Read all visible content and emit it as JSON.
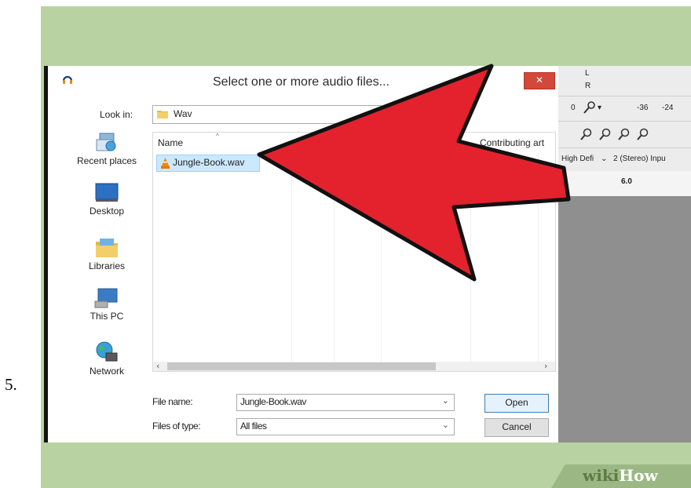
{
  "step_number": "5.",
  "dialog": {
    "title": "Select one or more audio files...",
    "close_glyph": "✕",
    "look_in_label": "Look in:",
    "look_in_value": "Wav",
    "places": [
      {
        "label": "Recent places",
        "icon": "recent-places-icon"
      },
      {
        "label": "Desktop",
        "icon": "desktop-icon"
      },
      {
        "label": "Libraries",
        "icon": "libraries-icon"
      },
      {
        "label": "This PC",
        "icon": "this-pc-icon"
      },
      {
        "label": "Network",
        "icon": "network-icon"
      }
    ],
    "columns": [
      "Name",
      "Contributing art"
    ],
    "files": [
      {
        "name": "Jungle-Book.wav",
        "icon": "vlc-icon",
        "selected": true
      }
    ],
    "file_name_label": "File name:",
    "file_name_value": "Jungle-Book.wav",
    "file_type_label": "Files of type:",
    "file_type_value": "All files",
    "open_label": "Open",
    "cancel_label": "Cancel"
  },
  "background_app": {
    "meter_left": "L",
    "meter_right": "R",
    "level_values": [
      "0",
      "-36",
      "-24"
    ],
    "host_value": "High Defi",
    "channels_value": "2 (Stereo) Inpu",
    "timeline_value": "6.0"
  },
  "annotation": {
    "arrow_color": "#e3222e"
  },
  "watermark": {
    "wiki": "wiki",
    "how": "How"
  }
}
